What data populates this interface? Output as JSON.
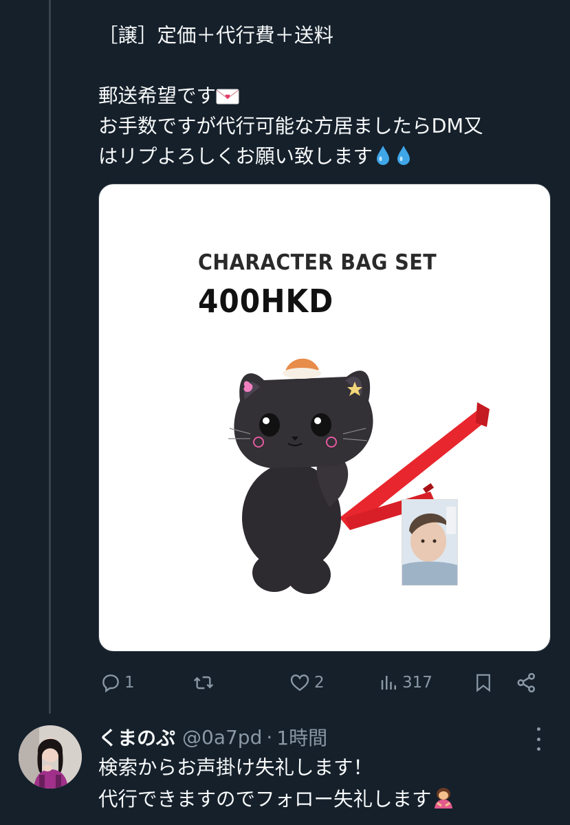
{
  "tweet": {
    "lines": [
      "［譲］定価＋代行費＋送料",
      "郵送希望です",
      "お手数ですが代行可能な方居ましたらDM又",
      "はリプよろしくお願い致します"
    ],
    "emoji": {
      "line2": "love-letter-icon",
      "line4": "droplet-icon"
    },
    "media": {
      "product_title": "CHARACTER BAG SET",
      "product_price": "400HKD"
    },
    "actions": {
      "reply_count": "1",
      "retweet_count": "",
      "like_count": "2",
      "view_count": "317"
    }
  },
  "reply": {
    "author_name": "くまのぷ",
    "author_handle": "@0a7pd",
    "separator": "·",
    "timestamp": "1時間",
    "lines": [
      "検索からお声掛け失礼します！",
      "代行できますのでフォロー失礼します"
    ]
  },
  "colors": {
    "background": "#15202b",
    "text": "#f7f9f9",
    "secondary_text": "#8b98a5",
    "strap_red": "#e8262d"
  }
}
